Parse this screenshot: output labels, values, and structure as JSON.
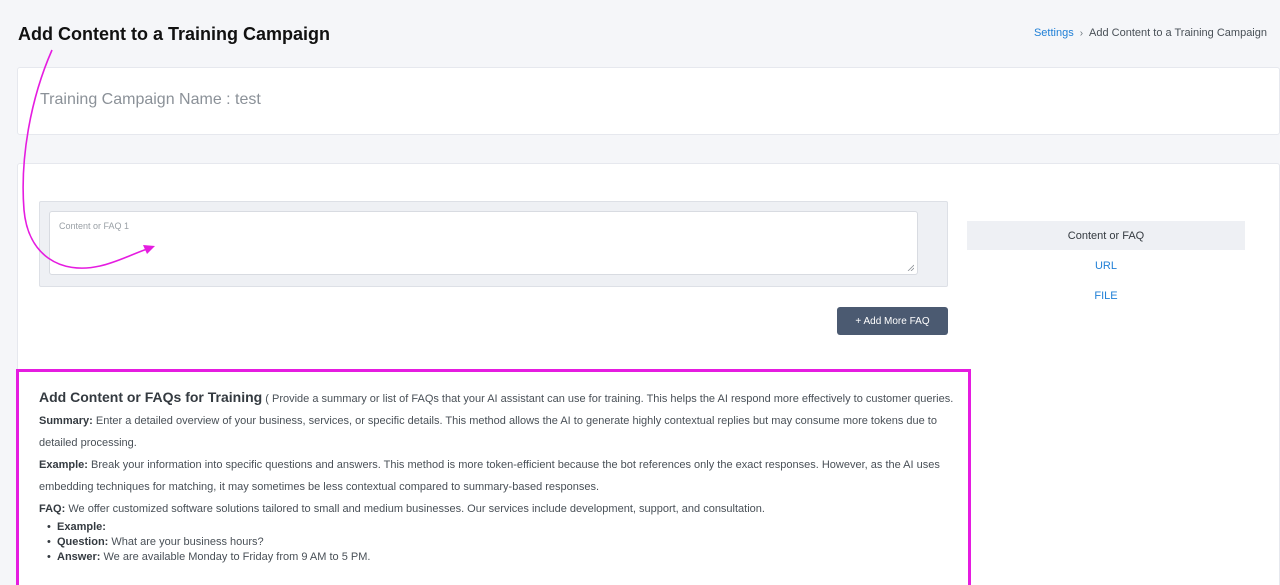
{
  "page": {
    "title": "Add Content to a Training Campaign"
  },
  "breadcrumb": {
    "link": "Settings",
    "separator": "›",
    "current": "Add Content to a Training Campaign"
  },
  "campaign": {
    "name_label": "Training Campaign Name : test"
  },
  "faq_input": {
    "placeholder": "Content or FAQ 1",
    "value": ""
  },
  "buttons": {
    "add_more_faq": "+ Add More FAQ"
  },
  "tabs": [
    {
      "label": "Content or FAQ",
      "active": true
    },
    {
      "label": "URL",
      "active": false
    },
    {
      "label": "FILE",
      "active": false
    }
  ],
  "info": {
    "heading": "Add Content or FAQs for Training",
    "intro": "( Provide a summary or list of FAQs that your AI assistant can use for training. This helps the AI respond more effectively to customer queries.",
    "summary_label": "Summary:",
    "summary_text": "Enter a detailed overview of your business, services, or specific details. This method allows the AI to generate highly contextual replies but may consume more tokens due to detailed processing.",
    "example_label": "Example:",
    "example_text": "Break your information into specific questions and answers. This method is more token-efficient because the bot references only the exact responses. However, as the AI uses embedding techniques for matching, it may sometimes be less contextual compared to summary-based responses.",
    "faq_label": "FAQ:",
    "faq_text": "We offer customized software solutions tailored to small and medium businesses. Our services include development, support, and consultation.",
    "bullets": [
      {
        "label": "Example:",
        "text": ""
      },
      {
        "label": "Question:",
        "text": "What are your business hours?"
      },
      {
        "label": "Answer:",
        "text": "We are available Monday to Friday from 9 AM to 5 PM."
      }
    ]
  },
  "colors": {
    "accent": "#e51ce0",
    "link": "#1f7fd6",
    "button": "#4b5a71"
  }
}
